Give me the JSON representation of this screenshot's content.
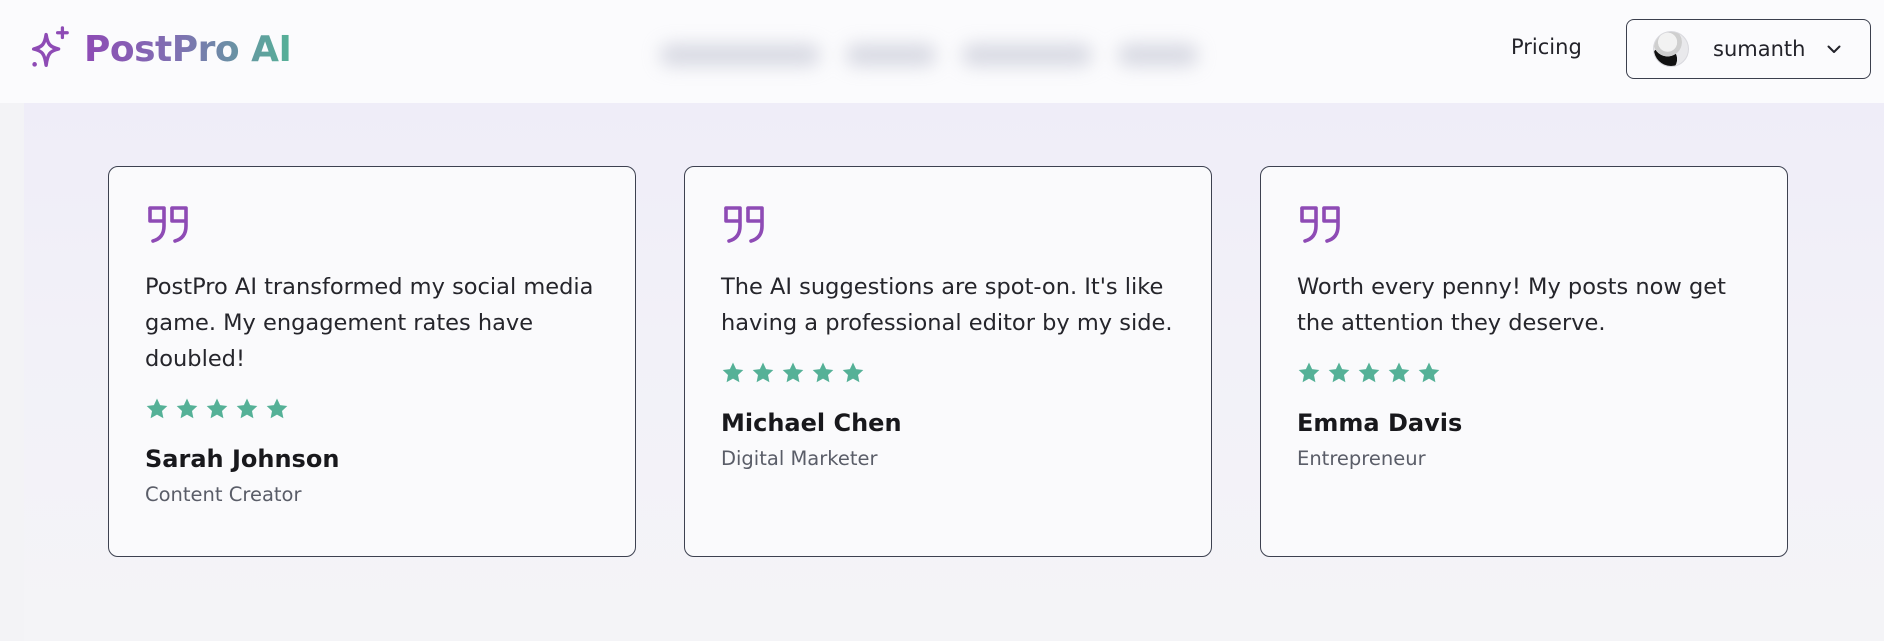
{
  "brand": {
    "name": "PostPro AI",
    "gradient": [
      "#8e4bb5",
      "#55b197"
    ],
    "icon": "sparkle-icon"
  },
  "nav": {
    "pricing_label": "Pricing"
  },
  "user": {
    "name": "sumanth",
    "avatar_icon": "avatar-image",
    "menu_icon": "chevron-down-icon"
  },
  "colors": {
    "quote": "#8e4bb5",
    "star": "#55b197",
    "border": "#3d4150"
  },
  "testimonials": [
    {
      "quote": "PostPro AI transformed my social media game. My engagement rates have doubled!",
      "rating": 5,
      "author": "Sarah Johnson",
      "role": "Content Creator"
    },
    {
      "quote": "The AI suggestions are spot-on. It's like having a professional editor by my side.",
      "rating": 5,
      "author": "Michael Chen",
      "role": "Digital Marketer"
    },
    {
      "quote": "Worth every penny! My posts now get the attention they deserve.",
      "rating": 5,
      "author": "Emma Davis",
      "role": "Entrepreneur"
    }
  ]
}
